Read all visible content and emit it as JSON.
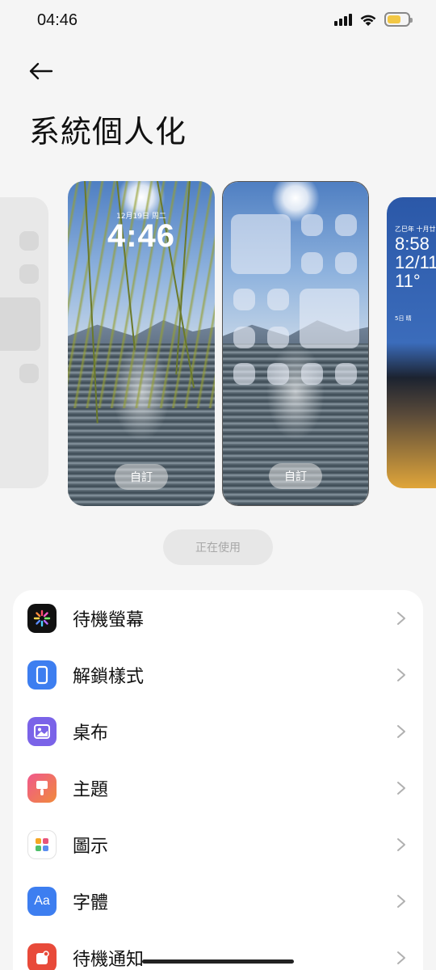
{
  "status_bar": {
    "time": "04:46",
    "battery_level": 0.65,
    "battery_color": "#f2c744"
  },
  "header": {
    "back_icon": "arrow-left-icon",
    "title": "系統個人化"
  },
  "carousel": {
    "lock_preview": {
      "date": "12月19日 周二",
      "time": "4:46",
      "customize_label": "自訂"
    },
    "home_preview": {
      "customize_label": "自訂"
    },
    "next_preview": {
      "date": "乙巳年 十月廿二",
      "time_line1": "8:58",
      "time_line2": "12/11",
      "temp": "11°",
      "small": "5日 晴"
    }
  },
  "in_use_label": "正在使用",
  "settings": {
    "items": [
      {
        "label": "待機螢幕",
        "icon": "always-on-display-icon",
        "color": "#111111"
      },
      {
        "label": "解鎖樣式",
        "icon": "unlock-style-icon",
        "color": "#3d7ef0"
      },
      {
        "label": "桌布",
        "icon": "wallpaper-icon",
        "color": "#7a63e8"
      },
      {
        "label": "主題",
        "icon": "theme-brush-icon",
        "color": "#e85a8a"
      },
      {
        "label": "圖示",
        "icon": "icons-grid-icon",
        "color": "#ffffff"
      },
      {
        "label": "字體",
        "icon": "font-aa-icon",
        "color": "#3d7ef0"
      },
      {
        "label": "待機通知",
        "icon": "standby-notification-icon",
        "color": "#e84a3a"
      }
    ],
    "font_icon_text": "Aa"
  }
}
